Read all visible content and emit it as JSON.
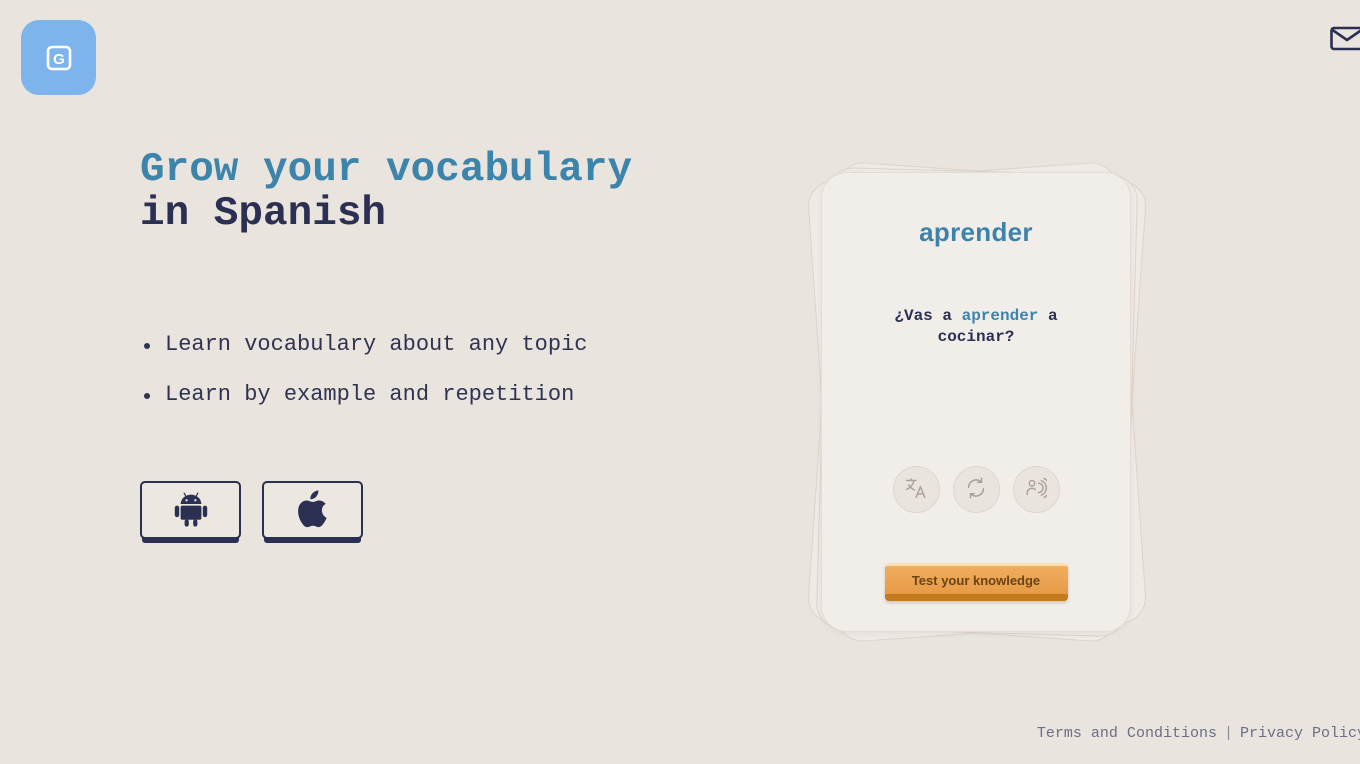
{
  "app": {
    "background_color": "#e9e4de",
    "accent_blue": "#3d84ab",
    "dark_navy": "#2b3052",
    "cta_orange": "#eda253"
  },
  "header": {
    "logo": {
      "icon": "app-logo-g-icon",
      "letter": "G",
      "tile_color": "#7eb4ec"
    },
    "mail_button": {
      "icon": "mail-envelope-icon",
      "label": ""
    }
  },
  "hero": {
    "headline_line1": "Grow your vocabulary",
    "headline_line2": "in Spanish",
    "features": [
      "Learn vocabulary about any topic",
      "Learn by example and repetition"
    ]
  },
  "stores": [
    {
      "name": "android-store-button",
      "icon": "android-robot-icon",
      "label": ""
    },
    {
      "name": "apple-store-button",
      "icon": "apple-logo-icon",
      "label": ""
    }
  ],
  "flashcard": {
    "word": "aprender",
    "sentence_before": "¿Vas a ",
    "sentence_highlight": "aprender",
    "sentence_after": " a cocinar?",
    "actions": [
      {
        "name": "translate-button",
        "icon": "translate-icon"
      },
      {
        "name": "flip-card-button",
        "icon": "refresh-icon"
      },
      {
        "name": "pronounce-button",
        "icon": "speaker-person-icon"
      }
    ],
    "cta_label": "Test your knowledge"
  },
  "footer": {
    "terms_label": "Terms and Conditions",
    "separator": "|",
    "privacy_label": "Privacy Policy"
  }
}
